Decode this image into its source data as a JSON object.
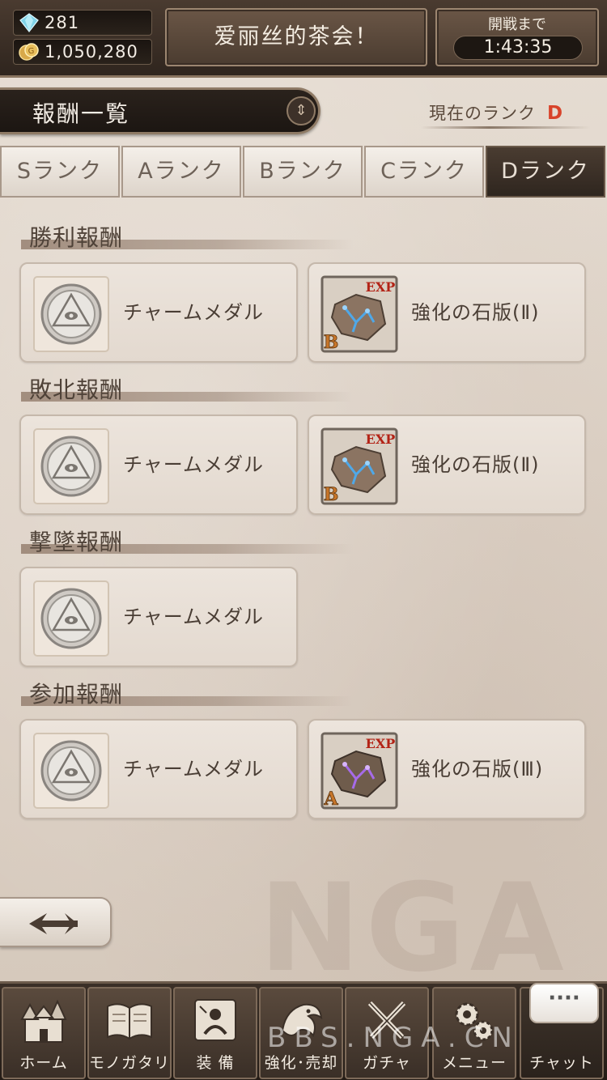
{
  "header": {
    "gems": "281",
    "coins": "1,050,280",
    "event_title": "爱丽丝的茶会！",
    "battle_label": "開戦まで",
    "battle_timer": "1:43:35"
  },
  "reward_list": {
    "title": "報酬一覧",
    "current_rank_label": "現在のランク",
    "current_rank_value": "D"
  },
  "tabs": [
    {
      "label": "Sランク"
    },
    {
      "label": "Aランク"
    },
    {
      "label": "Bランク"
    },
    {
      "label": "Cランク"
    },
    {
      "label": "Dランク"
    }
  ],
  "active_tab": "Dランク",
  "sections": [
    {
      "title": "勝利報酬",
      "items": [
        {
          "name": "チャームメダル",
          "icon": "charm-medal-icon"
        },
        {
          "name": "強化の石版(Ⅱ)",
          "icon": "exp-tablet-icon",
          "badge": "EXP",
          "grade": "B"
        }
      ]
    },
    {
      "title": "敗北報酬",
      "items": [
        {
          "name": "チャームメダル",
          "icon": "charm-medal-icon"
        },
        {
          "name": "強化の石版(Ⅱ)",
          "icon": "exp-tablet-icon",
          "badge": "EXP",
          "grade": "B"
        }
      ]
    },
    {
      "title": "撃墜報酬",
      "items": [
        {
          "name": "チャームメダル",
          "icon": "charm-medal-icon"
        }
      ]
    },
    {
      "title": "参加報酬",
      "items": [
        {
          "name": "チャームメダル",
          "icon": "charm-medal-icon"
        },
        {
          "name": "強化の石版(Ⅲ)",
          "icon": "exp-tablet-icon",
          "badge": "EXP",
          "grade": "A"
        }
      ]
    }
  ],
  "nav": [
    {
      "label": "ホーム",
      "icon": "castle-icon"
    },
    {
      "label": "モノガタリ",
      "icon": "book-icon"
    },
    {
      "label": "装 備",
      "icon": "equipment-icon"
    },
    {
      "label": "強化･売却",
      "icon": "dragon-icon"
    },
    {
      "label": "ガチャ",
      "icon": "swords-icon"
    },
    {
      "label": "メニュー",
      "icon": "gears-icon"
    },
    {
      "label": "チャット",
      "icon": "chat-icon"
    }
  ],
  "chat_bubble": "····",
  "watermark": {
    "logo": "NGA",
    "url": "BBS.NGA.CN"
  },
  "colors": {
    "rank_value": "#d8432a",
    "exp_badge": "#b32316",
    "tablet_glow_b": "#4fa8e8",
    "tablet_glow_a": "#a66be8"
  }
}
